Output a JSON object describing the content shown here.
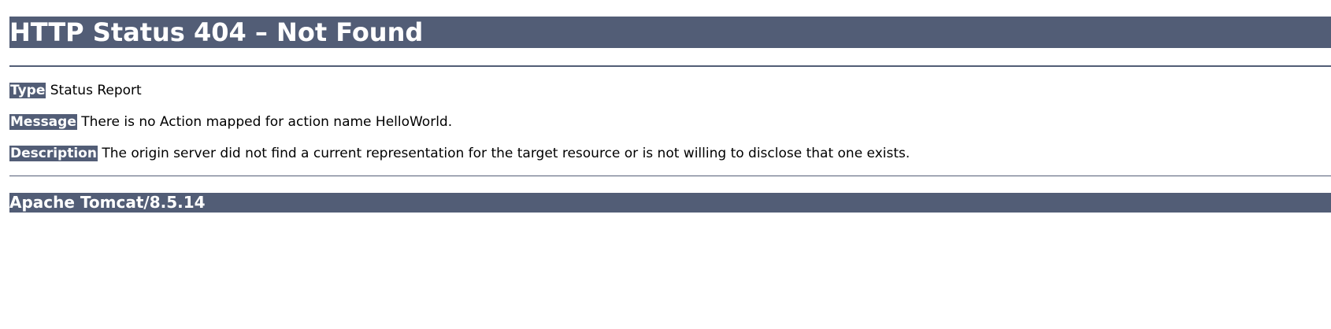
{
  "title": "HTTP Status 404 – Not Found",
  "type": {
    "label": "Type",
    "value": "Status Report"
  },
  "message": {
    "label": "Message",
    "value": "There is no Action mapped for action name HelloWorld."
  },
  "description": {
    "label": "Description",
    "value": "The origin server did not find a current representation for the target resource or is not willing to disclose that one exists."
  },
  "footer": "Apache Tomcat/8.5.14",
  "colors": {
    "bar": "#525d76",
    "bar_text": "#ffffff",
    "text": "#000000"
  }
}
